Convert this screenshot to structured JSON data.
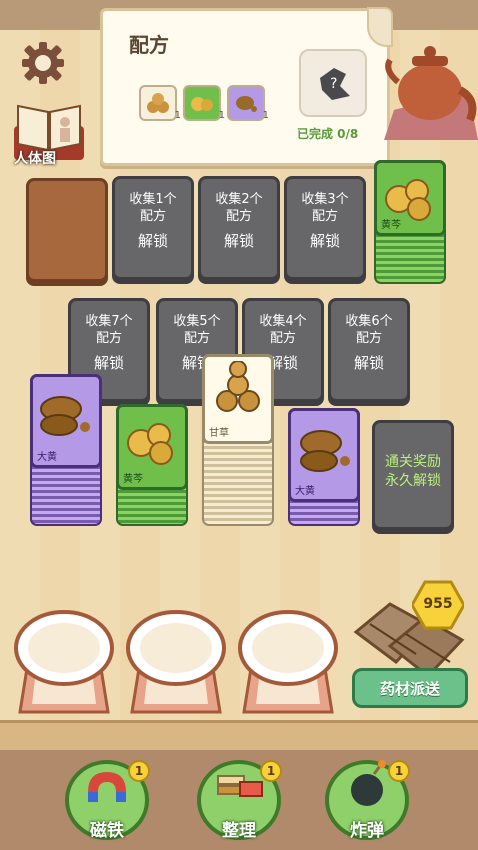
{
  "recipe": {
    "title": "配方",
    "ingredients": [
      {
        "icon": "licorice-slices-icon",
        "count": "1"
      },
      {
        "icon": "baical-skullcap-icon",
        "count": "1"
      },
      {
        "icon": "rhubarb-root-icon",
        "count": "1"
      }
    ],
    "progress_text": "已完成 0/8"
  },
  "sidebar": {
    "body_chart_label": "人体图"
  },
  "row1": [
    {
      "line1": "收集1个",
      "line2": "配方",
      "action": "解锁"
    },
    {
      "line1": "收集2个",
      "line2": "配方",
      "action": "解锁"
    },
    {
      "line1": "收集3个",
      "line2": "配方",
      "action": "解锁"
    }
  ],
  "row2": [
    {
      "line1": "收集7个",
      "line2": "配方",
      "action": "解锁"
    },
    {
      "line1": "收集5个",
      "line2": "配方",
      "action": "解锁"
    },
    {
      "line1": "收集4个",
      "line2": "配方",
      "action": "解锁"
    },
    {
      "line1": "收集6个",
      "line2": "配方",
      "action": "解锁"
    }
  ],
  "cards": {
    "huangqin_top": "黄芩",
    "dahuang_left": "大黄",
    "huangqin_mid": "黄芩",
    "gancao": "甘草",
    "dahuang_right": "大黄"
  },
  "reward": {
    "line1": "通关奖励",
    "line2": "永久解锁"
  },
  "coins": "955",
  "dispatch_label": "药材派送",
  "tools": [
    {
      "label": "磁铁",
      "count": "1",
      "icon": "magnet-icon"
    },
    {
      "label": "整理",
      "count": "1",
      "icon": "sort-icon"
    },
    {
      "label": "炸弹",
      "count": "1",
      "icon": "bomb-icon"
    }
  ],
  "colors": {
    "locked": "#67676a",
    "green": "#6fbf4a",
    "purple": "#b49ae6",
    "cream": "#f7f0dd"
  }
}
